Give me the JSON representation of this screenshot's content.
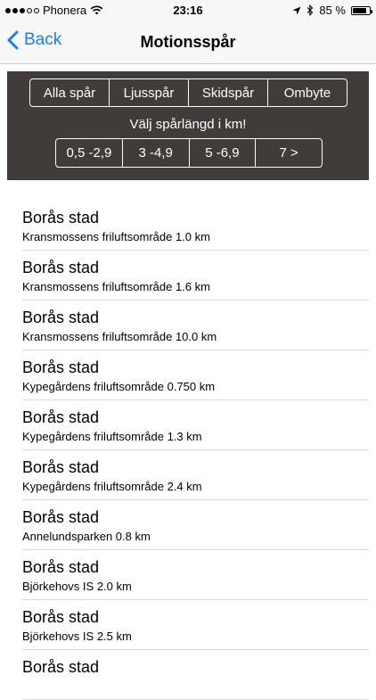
{
  "status_bar": {
    "carrier": "Phonera",
    "time": "23:16",
    "battery": "85 %",
    "battery_level": 0.85,
    "icons": [
      "signal-dots",
      "wifi-icon",
      "location-arrow-icon",
      "bluetooth-icon",
      "battery-icon"
    ]
  },
  "nav": {
    "back_label": "Back",
    "title": "Motionsspår"
  },
  "filters": {
    "types": [
      "Alla spår",
      "Ljusspår",
      "Skidspår",
      "Ombyte"
    ],
    "length_label": "Välj spårlängd i km!",
    "lengths": [
      "0,5 -2,9",
      "3 -4,9",
      "5 -6,9",
      "7 >"
    ]
  },
  "tracks": [
    {
      "title": "Borås stad",
      "subtitle": "Kransmossens friluftsområde  1.0 km"
    },
    {
      "title": "Borås stad",
      "subtitle": "Kransmossens friluftsområde  1.6 km"
    },
    {
      "title": "Borås stad",
      "subtitle": "Kransmossens friluftsområde  10.0 km"
    },
    {
      "title": "Borås stad",
      "subtitle": "Kypegårdens friluftsområde  0.750 km"
    },
    {
      "title": "Borås stad",
      "subtitle": "Kypegårdens friluftsområde  1.3 km"
    },
    {
      "title": "Borås stad",
      "subtitle": "Kypegårdens friluftsområde  2.4 km"
    },
    {
      "title": "Borås stad",
      "subtitle": "Annelundsparken  0.8 km"
    },
    {
      "title": "Borås stad",
      "subtitle": "Björkehovs IS  2.0 km"
    },
    {
      "title": "Borås stad",
      "subtitle": "Björkehovs IS  2.5 km"
    },
    {
      "title": "Borås stad",
      "subtitle": ""
    }
  ],
  "colors": {
    "accent": "#1a7cf6",
    "panel_bg": "#413b39",
    "bar_bg": "#f7f7f7"
  }
}
